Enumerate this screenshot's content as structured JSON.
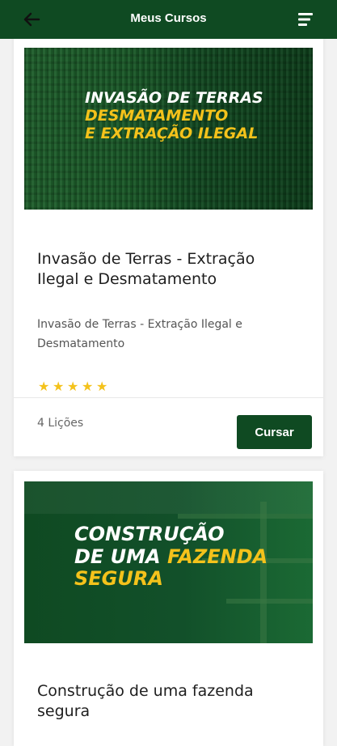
{
  "header": {
    "title": "Meus Cursos",
    "back_icon": "arrow-left-icon",
    "menu_icon": "menu-icon"
  },
  "courses": [
    {
      "banner_line1": "INVASÃO DE TERRAS",
      "banner_line2": "DESMATAMENTO",
      "banner_line3": "E EXTRAÇÃO ILEGAL",
      "title": "Invasão de Terras - Extração Ilegal e Desmatamento",
      "description": "Invasão de Terras - Extração Ilegal e Desmatamento",
      "rating": 5,
      "lessons": "4 Lições",
      "action": "Cursar"
    },
    {
      "banner_line1": "CONSTRUÇÃO",
      "banner_line2a": "DE UMA ",
      "banner_line2b": "FAZENDA",
      "banner_line3": "SEGURA",
      "title": "Construção de uma fazenda segura"
    }
  ],
  "colors": {
    "primary": "#0f4a22",
    "accent": "#f4c21b"
  }
}
